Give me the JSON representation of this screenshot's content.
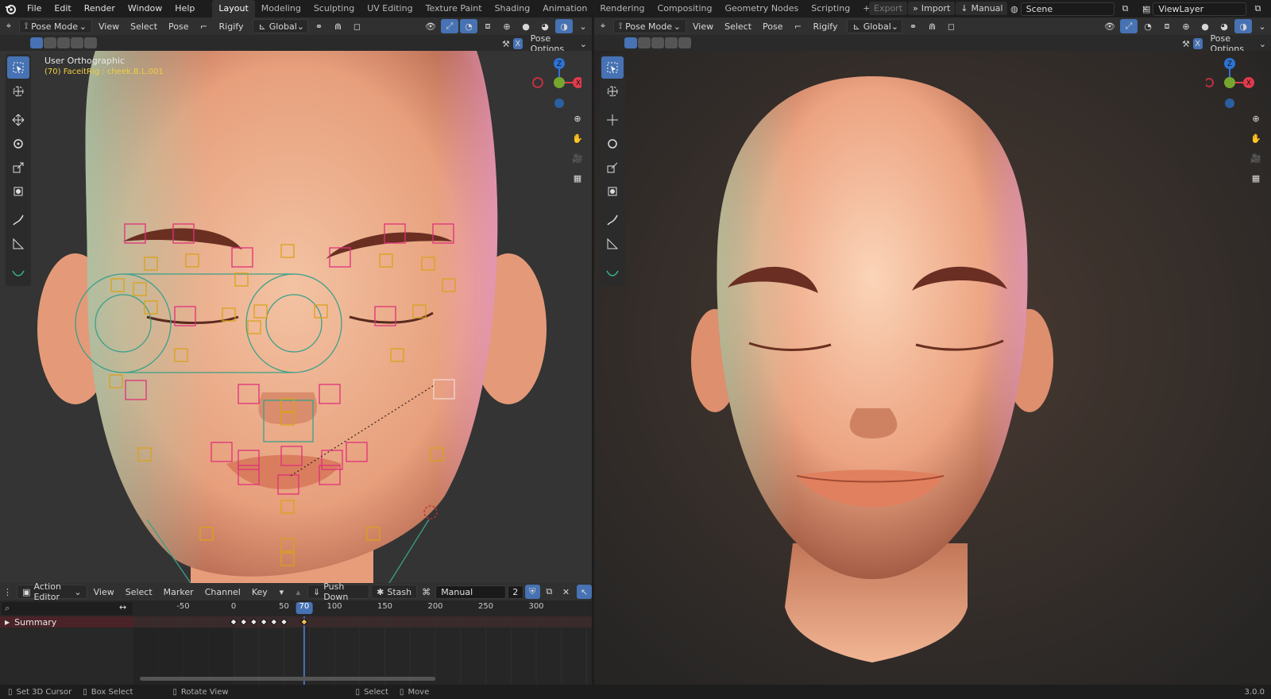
{
  "menus": [
    "File",
    "Edit",
    "Render",
    "Window",
    "Help"
  ],
  "workspaces": [
    "Layout",
    "Modeling",
    "Sculpting",
    "UV Editing",
    "Texture Paint",
    "Shading",
    "Animation",
    "Rendering",
    "Compositing",
    "Geometry Nodes",
    "Scripting"
  ],
  "active_workspace": "Layout",
  "top_right": {
    "export": "Export",
    "import": "Import",
    "manual": "Manual",
    "scene": "Scene",
    "view_layer": "ViewLayer"
  },
  "left_view": {
    "mode": "Pose Mode",
    "menus": [
      "View",
      "Select",
      "Pose"
    ],
    "rigify": "Rigify",
    "orientation": "Global",
    "pose_options": "Pose Options",
    "x_label": "X",
    "title": "User Orthographic",
    "subtitle": "(70) FaceitRig : cheek.B.L.001"
  },
  "right_view": {
    "mode": "Pose Mode",
    "menus": [
      "View",
      "Select",
      "Pose"
    ],
    "rigify": "Rigify",
    "orientation": "Global",
    "pose_options": "Pose Options",
    "x_label": "X"
  },
  "gizmo": {
    "z": "Z",
    "x": "X"
  },
  "action_editor": {
    "mode": "Action Editor",
    "menus": [
      "View",
      "Select",
      "Marker",
      "Channel",
      "Key"
    ],
    "push_down": "Push Down",
    "stash": "Stash",
    "action_name": "Manual",
    "users": "2",
    "current_frame": "70",
    "channel": "Summary",
    "ticks": [
      "-50",
      "0",
      "50",
      "100",
      "150",
      "200",
      "250",
      "300"
    ],
    "ticks_values": [
      -50,
      0,
      50,
      100,
      150,
      200,
      250,
      300
    ],
    "keyframes": [
      0,
      10,
      20,
      30,
      40,
      50,
      70
    ]
  },
  "status": {
    "a": "Set 3D Cursor",
    "b": "Box Select",
    "c": "Rotate View",
    "d": "Select",
    "e": "Move",
    "version": "3.0.0"
  },
  "colors": {
    "accent": "#4772b3",
    "bone_pink": "#e0307a",
    "bone_yellow": "#d9a21a",
    "bone_teal": "#3aa08a",
    "skin": "#f0b08c"
  }
}
